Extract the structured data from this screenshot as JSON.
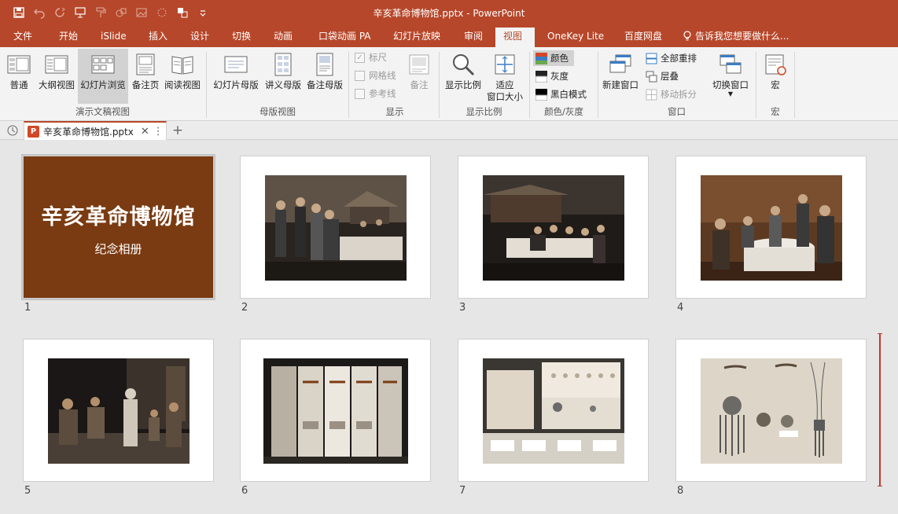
{
  "window": {
    "title": "辛亥革命博物馆.pptx - PowerPoint"
  },
  "tabs": [
    "文件",
    "开始",
    "iSlide",
    "插入",
    "设计",
    "切换",
    "动画",
    "口袋动画 PA",
    "幻灯片放映",
    "审阅",
    "视图",
    "OneKey Lite",
    "百度网盘"
  ],
  "tell_me": "告诉我您想要做什么...",
  "ribbon": {
    "views": {
      "normal": "普通",
      "outline": "大纲视图",
      "sorter": "幻灯片浏览",
      "notes": "备注页",
      "reading": "阅读视图",
      "group": "演示文稿视图"
    },
    "masters": {
      "slide_master": "幻灯片母版",
      "handout_master": "讲义母版",
      "notes_master": "备注母版",
      "group": "母版视图"
    },
    "show": {
      "ruler": "标尺",
      "gridlines": "网格线",
      "guides": "参考线",
      "notes": "备注",
      "group": "显示"
    },
    "zoom": {
      "zoom": "显示比例",
      "fit_line1": "适应",
      "fit_line2": "窗口大小",
      "group": "显示比例"
    },
    "color": {
      "color": "颜色",
      "gray": "灰度",
      "bw": "黑白模式",
      "group": "颜色/灰度"
    },
    "window": {
      "new_window": "新建窗口",
      "arrange_all": "全部重排",
      "cascade": "层叠",
      "move_split": "移动拆分",
      "switch_windows": "切换窗口",
      "group": "窗口"
    },
    "macros": {
      "macros": "宏",
      "group": "宏"
    }
  },
  "doc_tab": {
    "name": "辛亥革命博物馆.pptx",
    "badge": "P"
  },
  "slides": [
    {
      "num": "1",
      "title": "辛亥革命博物馆",
      "subtitle": "纪念相册"
    },
    {
      "num": "2"
    },
    {
      "num": "3"
    },
    {
      "num": "4"
    },
    {
      "num": "5"
    },
    {
      "num": "6"
    },
    {
      "num": "7"
    },
    {
      "num": "8"
    }
  ],
  "colors": {
    "accent": "#b7472a",
    "title_slide_bg": "#7a3b12"
  }
}
